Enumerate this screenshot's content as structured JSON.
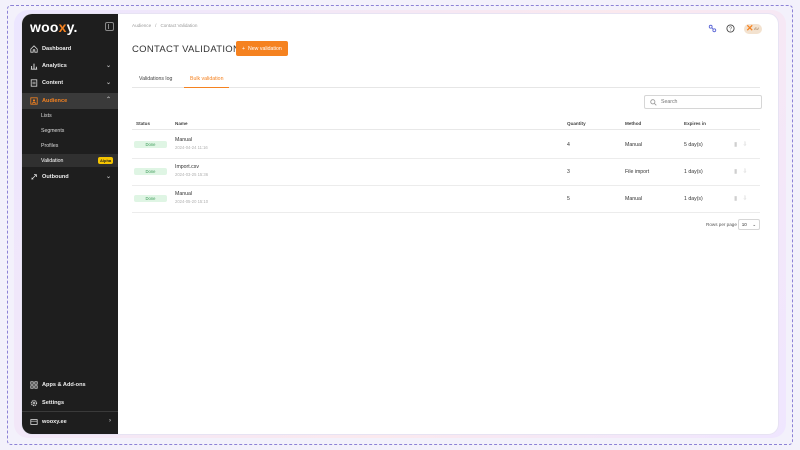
{
  "brand": {
    "logo_text": "woo",
    "logo_x": "x",
    "logo_tail": "y.",
    "accent": "#f58220",
    "sidebar_bg": "#1e1e1e"
  },
  "sidebar": {
    "items": [
      {
        "label": "Dashboard",
        "icon": "home-icon"
      },
      {
        "label": "Analytics",
        "icon": "bar-chart-icon"
      },
      {
        "label": "Content",
        "icon": "document-icon"
      },
      {
        "label": "Audience",
        "icon": "audience-icon"
      },
      {
        "label": "Outbound",
        "icon": "rocket-icon"
      }
    ],
    "audience_sub": [
      "Lists",
      "Segments",
      "Profiles",
      "Validation"
    ],
    "alpha_badge": "Alpha",
    "bottom": [
      {
        "label": "Apps & Add-ons",
        "icon": "apps-grid-icon"
      },
      {
        "label": "Settings",
        "icon": "gear-icon"
      },
      {
        "label": "wooxy.ee",
        "icon": "workspace-icon"
      }
    ]
  },
  "breadcrumb": [
    "Audience",
    "Contact Validation"
  ],
  "header": {
    "title": "CONTACT VALIDATION",
    "new_button": "New validation"
  },
  "tabs": [
    "Validations log",
    "Bulk validation"
  ],
  "search": {
    "placeholder": "Search"
  },
  "table": {
    "columns": [
      "Status",
      "Name",
      "Quantity",
      "Method",
      "Expires in"
    ],
    "rows": [
      {
        "status": "Done",
        "name": "Manual",
        "date": "2024-04-24 11:16",
        "quantity": "4",
        "method": "Manual",
        "expires": "5 day(s)"
      },
      {
        "status": "Done",
        "name": "Import.csv",
        "date": "2024-03-25 15:36",
        "quantity": "3",
        "method": "File import",
        "expires": "1 day(s)"
      },
      {
        "status": "Done",
        "name": "Manual",
        "date": "2024-05-20 15:10",
        "quantity": "5",
        "method": "Manual",
        "expires": "1 day(s)"
      }
    ]
  },
  "pagination": {
    "label": "Rows per page",
    "value": "10"
  },
  "user": {
    "avatar_text": "AV"
  }
}
